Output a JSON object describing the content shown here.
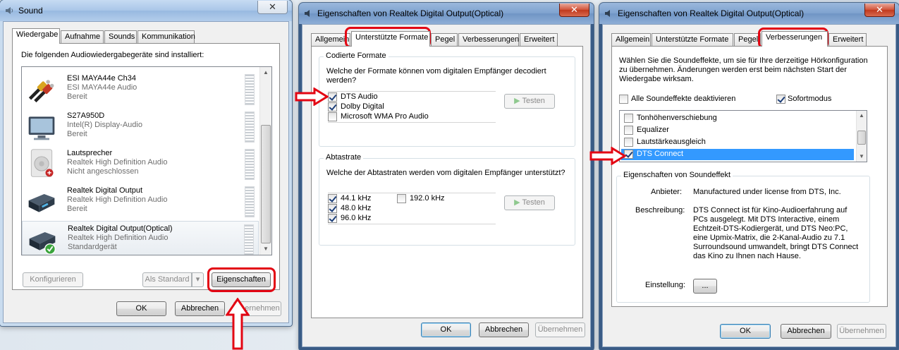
{
  "sound_window": {
    "title": "Sound",
    "tabs": [
      "Wiedergabe",
      "Aufnahme",
      "Sounds",
      "Kommunikation"
    ],
    "intro": "Die folgenden Audiowiedergabegeräte sind installiert:",
    "devices": [
      {
        "name": "ESI MAYA44e Ch34",
        "driver": "ESI MAYA44e Audio",
        "status": "Bereit"
      },
      {
        "name": "S27A950D",
        "driver": "Intel(R) Display-Audio",
        "status": "Bereit"
      },
      {
        "name": "Lautsprecher",
        "driver": "Realtek High Definition Audio",
        "status": "Nicht angeschlossen"
      },
      {
        "name": "Realtek Digital Output",
        "driver": "Realtek High Definition Audio",
        "status": "Bereit"
      },
      {
        "name": "Realtek Digital Output(Optical)",
        "driver": "Realtek High Definition Audio",
        "status": "Standardgerät"
      }
    ],
    "buttons": {
      "configure": "Konfigurieren",
      "set_default": "Als Standard",
      "properties": "Eigenschaften",
      "ok": "OK",
      "cancel": "Abbrechen",
      "apply": "Übernehmen"
    }
  },
  "props_formats_window": {
    "title": "Eigenschaften von Realtek Digital Output(Optical)",
    "tabs": [
      "Allgemein",
      "Unterstützte Formate",
      "Pegel",
      "Verbesserungen",
      "Erweitert"
    ],
    "encoded_group": {
      "legend": "Codierte Formate",
      "question": "Welche der Formate können vom digitalen Empfänger decodiert werden?",
      "formats": [
        {
          "label": "DTS Audio",
          "checked": true
        },
        {
          "label": "Dolby Digital",
          "checked": true
        },
        {
          "label": "Microsoft WMA Pro Audio",
          "checked": false
        }
      ],
      "test_button": "Testen"
    },
    "rate_group": {
      "legend": "Abtastrate",
      "question": "Welche der Abtastraten werden vom digitalen Empfänger unterstützt?",
      "rates": [
        {
          "label": "44.1 kHz",
          "checked": true
        },
        {
          "label": "48.0 kHz",
          "checked": true
        },
        {
          "label": "96.0 kHz",
          "checked": true
        },
        {
          "label": "192.0 kHz",
          "checked": false
        }
      ],
      "test_button": "Testen"
    },
    "buttons": {
      "ok": "OK",
      "cancel": "Abbrechen",
      "apply": "Übernehmen"
    }
  },
  "props_enhance_window": {
    "title": "Eigenschaften von Realtek Digital Output(Optical)",
    "tabs": [
      "Allgemein",
      "Unterstützte Formate",
      "Pegel",
      "Verbesserungen",
      "Erweitert"
    ],
    "intro": "Wählen Sie die Soundeffekte, um sie für Ihre derzeitige Hörkonfiguration zu übernehmen. Änderungen werden erst beim nächsten Start der Wiedergabe wirksam.",
    "disable_all": {
      "label": "Alle Soundeffekte deaktivieren",
      "checked": false
    },
    "immediate": {
      "label": "Sofortmodus",
      "checked": true
    },
    "effects": [
      {
        "label": "Tonhöhenverschiebung",
        "checked": false
      },
      {
        "label": "Equalizer",
        "checked": false
      },
      {
        "label": "Lautstärkeausgleich",
        "checked": false
      },
      {
        "label": "DTS Connect",
        "checked": true
      }
    ],
    "effect_props": {
      "legend": "Eigenschaften von Soundeffekt",
      "provider_label": "Anbieter:",
      "provider_value": "Manufactured under license from DTS, Inc.",
      "description_label": "Beschreibung:",
      "description_value": "DTS Connect ist für Kino-Audioerfahrung auf PCs ausgelegt. Mit DTS Interactive, einem Echtzeit-DTS-Kodiergerät, und DTS Neo:PC, eine Upmix-Matrix, die 2-Kanal-Audio zu 7.1 Surroundsound umwandelt, bringt DTS Connect das Kino zu Ihnen nach Hause.",
      "setting_label": "Einstellung:",
      "setting_button": "..."
    },
    "buttons": {
      "ok": "OK",
      "cancel": "Abbrechen",
      "apply": "Übernehmen"
    }
  },
  "colors": {
    "highlight_ring": "#e30613",
    "selection": "#3399ff"
  }
}
